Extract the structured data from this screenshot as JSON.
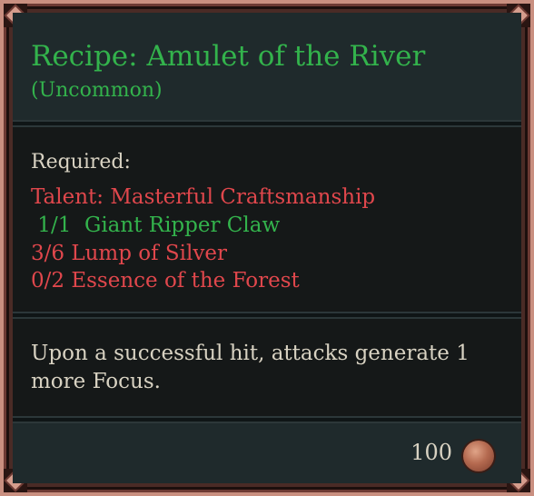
{
  "tooltip": {
    "title": "Recipe: Amulet of the River",
    "rarity": "(Uncommon)",
    "required_label": "Required:",
    "requirements": [
      {
        "text": "Talent: Masterful Craftsmanship",
        "status": "unmet",
        "color": "#e0474c"
      },
      {
        "text": " 1/1  Giant Ripper Claw",
        "status": "met",
        "color": "#33b34c"
      },
      {
        "text": "3/6 Lump of Silver",
        "status": "unmet",
        "color": "#e0474c"
      },
      {
        "text": "0/2 Essence of the Forest",
        "status": "unmet",
        "color": "#e0474c"
      }
    ],
    "description": "Upon a successful hit, attacks generate 1 more Focus.",
    "cost": "100",
    "cost_icon": "copper-coin-icon"
  },
  "colors": {
    "title_green": "#33b34c",
    "unmet_red": "#e0474c",
    "text_light": "#d8d2c2",
    "frame_border": "#c98f80"
  }
}
